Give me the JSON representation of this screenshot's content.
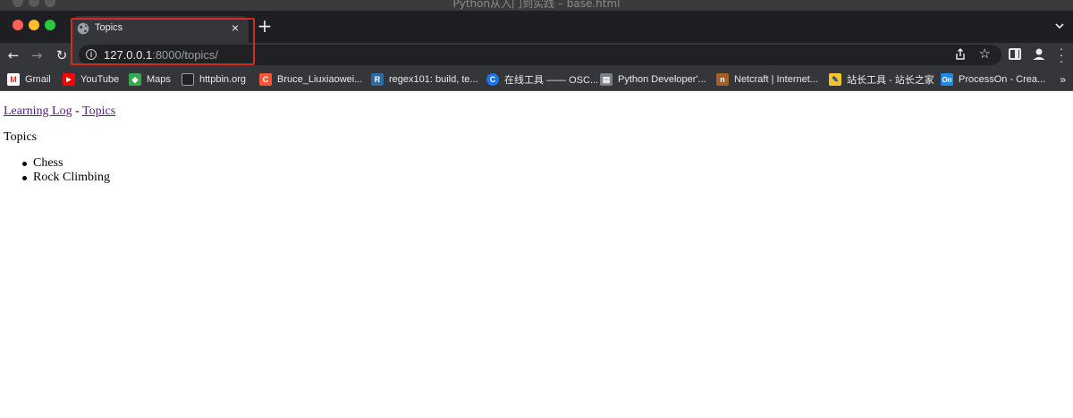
{
  "window": {
    "title": "Python从入门到实践 – base.html"
  },
  "tab": {
    "title": "Topics",
    "close": "×"
  },
  "newtab": {
    "label": "+"
  },
  "toolbar": {
    "back": "←",
    "forward": "→",
    "reload": "↻",
    "url_host": "127.0.0.1",
    "url_rest": ":8000/topics/",
    "star": "☆"
  },
  "bookmarks": {
    "items": [
      {
        "label": "Gmail",
        "icon": "gmail-icon",
        "color": "#d93025",
        "glyph": "M"
      },
      {
        "label": "YouTube",
        "icon": "youtube-icon",
        "color": "#ff0000",
        "glyph": "▶"
      },
      {
        "label": "Maps",
        "icon": "maps-icon",
        "color": "#34a853",
        "glyph": "◆"
      },
      {
        "label": "httpbin.org",
        "icon": "httpbin-icon",
        "color": "#35363a",
        "glyph": "▥"
      },
      {
        "label": "Bruce_Liuxiaowei...",
        "icon": "csdn-icon",
        "color": "#fc5531",
        "glyph": "C"
      },
      {
        "label": "regex101: build, te...",
        "icon": "regex101-icon",
        "color": "#2c6ca6",
        "glyph": "R"
      },
      {
        "label": "在线工具 —— OSC...",
        "icon": "oschina-icon",
        "color": "#1a73e8",
        "glyph": "C"
      },
      {
        "label": "Python Developer'...",
        "icon": "python-docs-icon",
        "color": "#7c8089",
        "glyph": "▤"
      },
      {
        "label": "Netcraft | Internet...",
        "icon": "netcraft-icon",
        "color": "#a1612a",
        "glyph": "n"
      },
      {
        "label": "站长工具 - 站长之家",
        "icon": "chinaz-icon",
        "color": "#f4c430",
        "glyph": "✎"
      },
      {
        "label": "ProcessOn - Crea...",
        "icon": "processon-icon",
        "color": "#1e88e5",
        "glyph": "On"
      }
    ],
    "more": "»"
  },
  "page": {
    "nav_home": "Learning Log",
    "nav_sep": "-",
    "nav_topics": "Topics",
    "heading": "Topics",
    "topics": [
      "Chess",
      "Rock Climbing"
    ]
  }
}
